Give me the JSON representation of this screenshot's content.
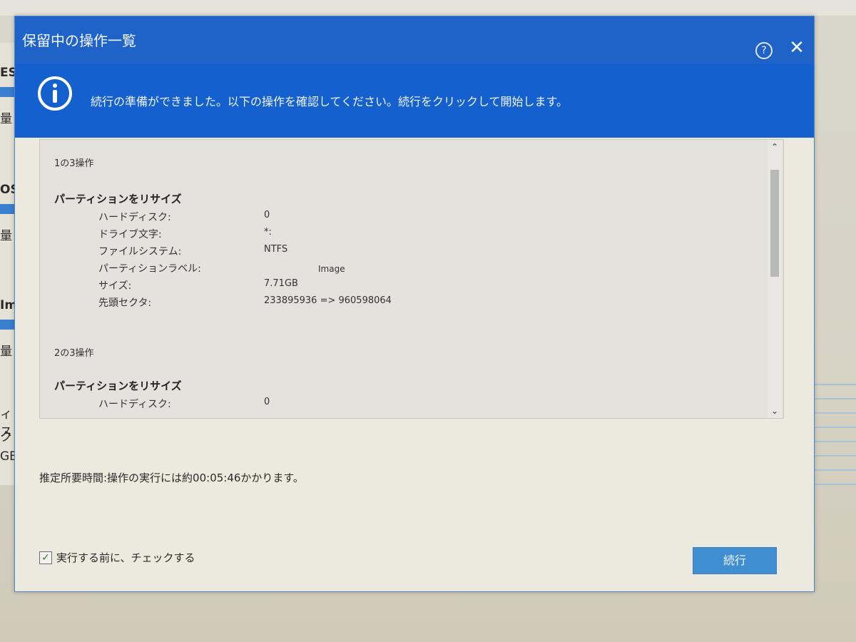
{
  "dialog": {
    "title": "保留中の操作一覧",
    "help_label": "?",
    "close_label": "✕",
    "info_text": "続行の準備ができました。以下の操作を確認してください。続行をクリックして開始します。"
  },
  "operations": [
    {
      "index_label": "1の3操作",
      "title": "パーティションをリサイズ",
      "rows": [
        {
          "label": "ハードディスク:",
          "value": "0"
        },
        {
          "label": "ドライブ文字:",
          "value": "*:"
        },
        {
          "label": "ファイルシステム:",
          "value": "NTFS"
        },
        {
          "label": "パーティションラベル:",
          "value": "Image"
        },
        {
          "label": "サイズ:",
          "value": "7.71GB"
        },
        {
          "label": "先頭セクタ:",
          "value": "233895936 => 960598064"
        }
      ]
    },
    {
      "index_label": "2の3操作",
      "title": "パーティションをリサイズ",
      "rows": [
        {
          "label": "ハードディスク:",
          "value": "0"
        }
      ]
    }
  ],
  "scrollbar": {
    "up": "⌃",
    "down": "⌄"
  },
  "estimate_text": "推定所要時間:操作の実行には約00:05:46かかります。",
  "check_before_run": {
    "checked": true,
    "mark": "✓",
    "label": "実行する前に、チェックする"
  },
  "continue_label": "続行",
  "background_fragments": [
    "ES",
    "量",
    "OS",
    "量",
    "Im",
    "量",
    "ィス",
    "ク",
    "GB"
  ]
}
